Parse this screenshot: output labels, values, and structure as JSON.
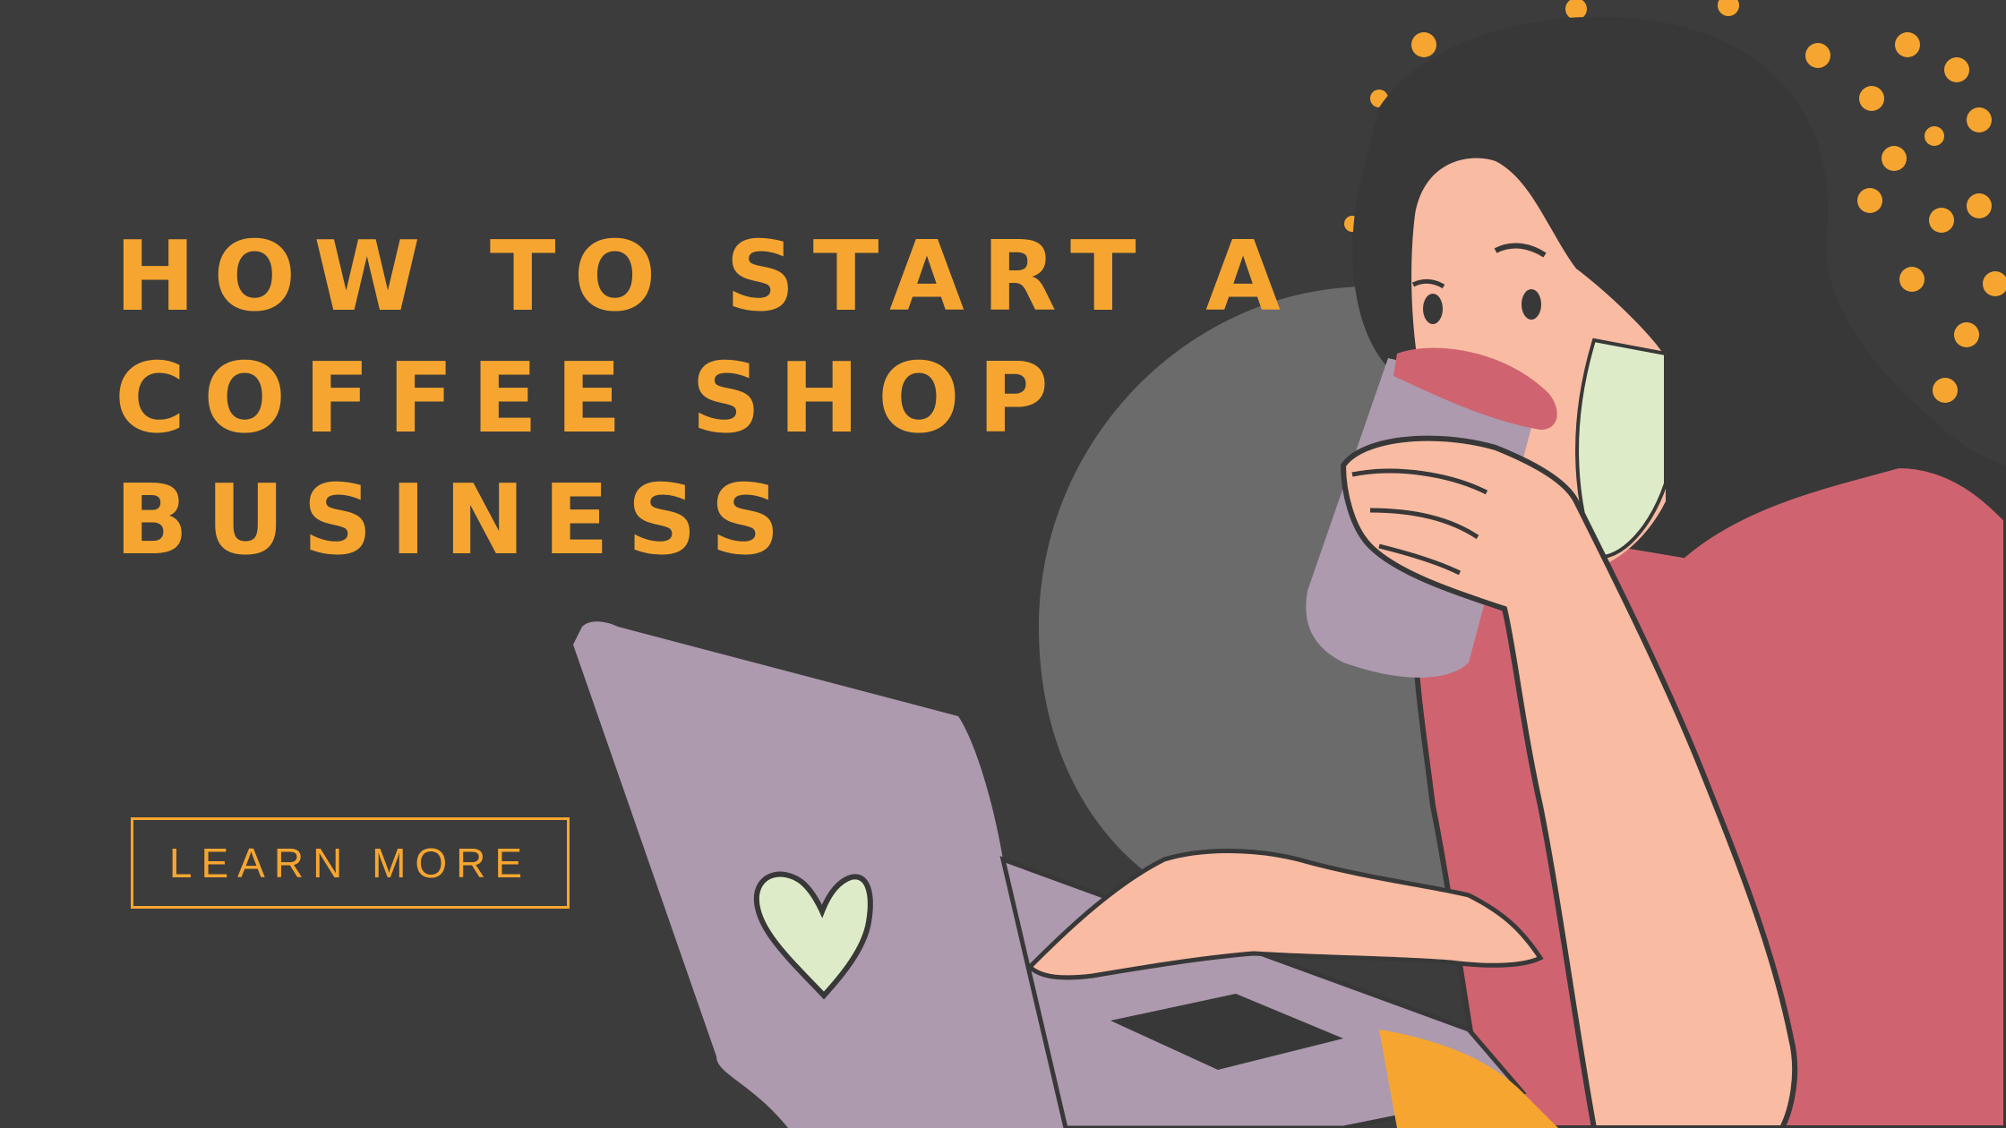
{
  "headline": {
    "line1": "HOW TO START A",
    "line2": "COFFEE SHOP",
    "line3": "BUSINESS"
  },
  "cta": {
    "label": "LEARN MORE"
  },
  "colors": {
    "background": "#3c3c3c",
    "accent": "#f6a630",
    "laptop": "#ad9aae",
    "shirt": "#cf6470",
    "skin": "#f9bba2",
    "heart": "#deebc9",
    "hair": "#383838",
    "backdrop_circle": "#6b6b6b"
  },
  "illustration": {
    "subject": "woman-drinking-coffee-at-laptop",
    "icons": [
      "heart-icon",
      "coffee-cup-icon",
      "laptop-icon"
    ]
  }
}
